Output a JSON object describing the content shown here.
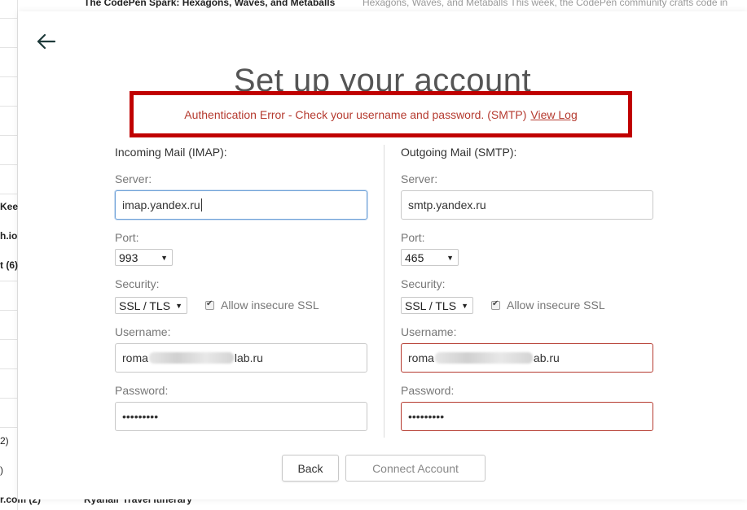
{
  "background": {
    "top_subject": "The CodePen Spark: Hexagons, Waves, and Metaballs",
    "top_preview": "Hexagons, Waves, and Metaballs This week, the CodePen community crafts code in",
    "left_fragments": [
      "Keep",
      "h.io",
      "t (6)",
      "2)",
      ")"
    ],
    "bottom_sender": "r.com (2)",
    "bottom_subject": "Ryanair Travel Itinerary"
  },
  "modal": {
    "title": "Set up your account",
    "error": {
      "message": "Authentication Error - Check your username and password. (SMTP)",
      "link": "View Log"
    },
    "incoming": {
      "heading": "Incoming Mail (IMAP):",
      "server_label": "Server:",
      "server_value": "imap.yandex.ru",
      "port_label": "Port:",
      "port_value": "993",
      "security_label": "Security:",
      "security_value": "SSL / TLS",
      "insecure_label": "Allow insecure SSL",
      "username_label": "Username:",
      "username_prefix": "roma",
      "username_suffix": "lab.ru",
      "password_label": "Password:",
      "password_value": "•••••••••"
    },
    "outgoing": {
      "heading": "Outgoing Mail (SMTP):",
      "server_label": "Server:",
      "server_value": "smtp.yandex.ru",
      "port_label": "Port:",
      "port_value": "465",
      "security_label": "Security:",
      "security_value": "SSL / TLS",
      "insecure_label": "Allow insecure SSL",
      "username_label": "Username:",
      "username_prefix": "roma",
      "username_suffix": "ab.ru",
      "password_label": "Password:",
      "password_value": "•••••••••"
    },
    "buttons": {
      "back": "Back",
      "connect": "Connect Account"
    }
  },
  "colors": {
    "error_border": "#c00000",
    "error_text": "#b53a2f",
    "focus_border": "#6ea1d8"
  }
}
